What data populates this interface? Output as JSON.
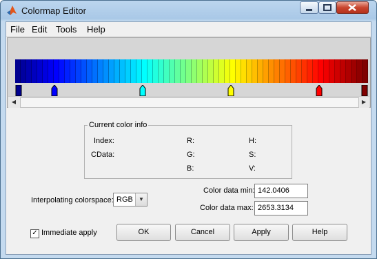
{
  "window": {
    "title": "Colormap Editor"
  },
  "menu": [
    {
      "label": "File"
    },
    {
      "label": "Edit"
    },
    {
      "label": "Tools"
    },
    {
      "label": "Help"
    }
  ],
  "colormap": {
    "colors": [
      "#00008f",
      "#00009f",
      "#0000af",
      "#0000bf",
      "#0000cf",
      "#0000df",
      "#0000ef",
      "#0000ff",
      "#0010ff",
      "#0020ff",
      "#0030ff",
      "#0040ff",
      "#0050ff",
      "#0060ff",
      "#0070ff",
      "#0080ff",
      "#008fff",
      "#009fff",
      "#00afff",
      "#00bfff",
      "#00cfff",
      "#00dfff",
      "#00efff",
      "#00ffff",
      "#10ffef",
      "#20ffdf",
      "#30ffcf",
      "#40ffbf",
      "#50ffaf",
      "#60ff9f",
      "#70ff8f",
      "#80ff80",
      "#8fff70",
      "#9fff60",
      "#afff50",
      "#bfff40",
      "#cfff30",
      "#dfff20",
      "#efff10",
      "#ffff00",
      "#ffef00",
      "#ffdf00",
      "#ffcf00",
      "#ffbf00",
      "#ffaf00",
      "#ff9f00",
      "#ff8f00",
      "#ff8000",
      "#ff7000",
      "#ff6000",
      "#ff5000",
      "#ff4000",
      "#ff3000",
      "#ff2000",
      "#ff1000",
      "#ff0000",
      "#ef0000",
      "#df0000",
      "#cf0000",
      "#bf0000",
      "#af0000",
      "#9f0000",
      "#8f0000",
      "#800000"
    ],
    "markers": [
      {
        "color": "#00008f",
        "shape": "rect"
      },
      {
        "color": "#0000ff",
        "shape": "arrow"
      },
      {
        "color": "#00ffff",
        "shape": "arrow"
      },
      {
        "color": "#ffff00",
        "shape": "arrow"
      },
      {
        "color": "#ff0000",
        "shape": "arrow"
      },
      {
        "color": "#800000",
        "shape": "rect"
      }
    ]
  },
  "info": {
    "legend": "Current color info",
    "index_label": "Index:",
    "cdata_label": "CData:",
    "r_label": "R:",
    "g_label": "G:",
    "b_label": "B:",
    "h_label": "H:",
    "s_label": "S:",
    "v_label": "V:"
  },
  "controls": {
    "interp_label": "Interpolating colorspace:",
    "interp_value": "RGB",
    "cmin_label": "Color data min:",
    "cmin_value": "142.0406",
    "cmax_label": "Color data max:",
    "cmax_value": "2653.3134",
    "immediate_label": "Immediate apply",
    "immediate_checked": true
  },
  "buttons": {
    "ok": "OK",
    "cancel": "Cancel",
    "apply": "Apply",
    "help": "Help"
  },
  "icons": [
    "matlab-icon",
    "minimize-icon",
    "maximize-icon",
    "close-icon",
    "scroll-left-icon",
    "scroll-right-icon",
    "dropdown-arrow-icon",
    "checkmark-icon"
  ]
}
